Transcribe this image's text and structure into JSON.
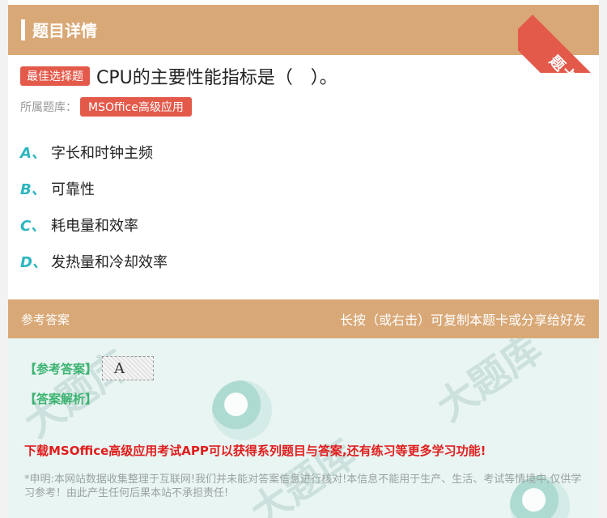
{
  "header": {
    "title": "题目详情",
    "ribbon_label": "题卡"
  },
  "question": {
    "type_tag": "最佳选择题",
    "text": "CPU的主要性能指标是（　）。",
    "bank_label": "所属题库：",
    "bank_name": "MSOffice高级应用"
  },
  "options": [
    {
      "letter": "A、",
      "text": "字长和时钟主频"
    },
    {
      "letter": "B、",
      "text": "可靠性"
    },
    {
      "letter": "C、",
      "text": "耗电量和效率"
    },
    {
      "letter": "D、",
      "text": "发热量和冷却效率"
    }
  ],
  "answer_section": {
    "title": "参考答案",
    "hint": "长按（或右击）可复制本题卡或分享给好友",
    "ref_label": "【参考答案】",
    "ref_value": "A",
    "analysis_label": "【答案解析】",
    "promo": "下载MSOffice高级应用考试APP可以获得系列题目与答案,还有练习等更多学习功能!",
    "disclaimer": "*申明:本网站数据收集整理于互联网!我们并未能对答案信息进行核对!本信息不能用于生产、生活、考试等情境中,仅供学习参考！由此产生任何后果本站不承担责任!"
  },
  "colors": {
    "header": "#d9a877",
    "tag": "#e35a4b",
    "option_letter": "#2cb6c0",
    "body_bg": "#e8f5f2",
    "promo": "#e01d1d",
    "ref_label": "#3cb371"
  }
}
